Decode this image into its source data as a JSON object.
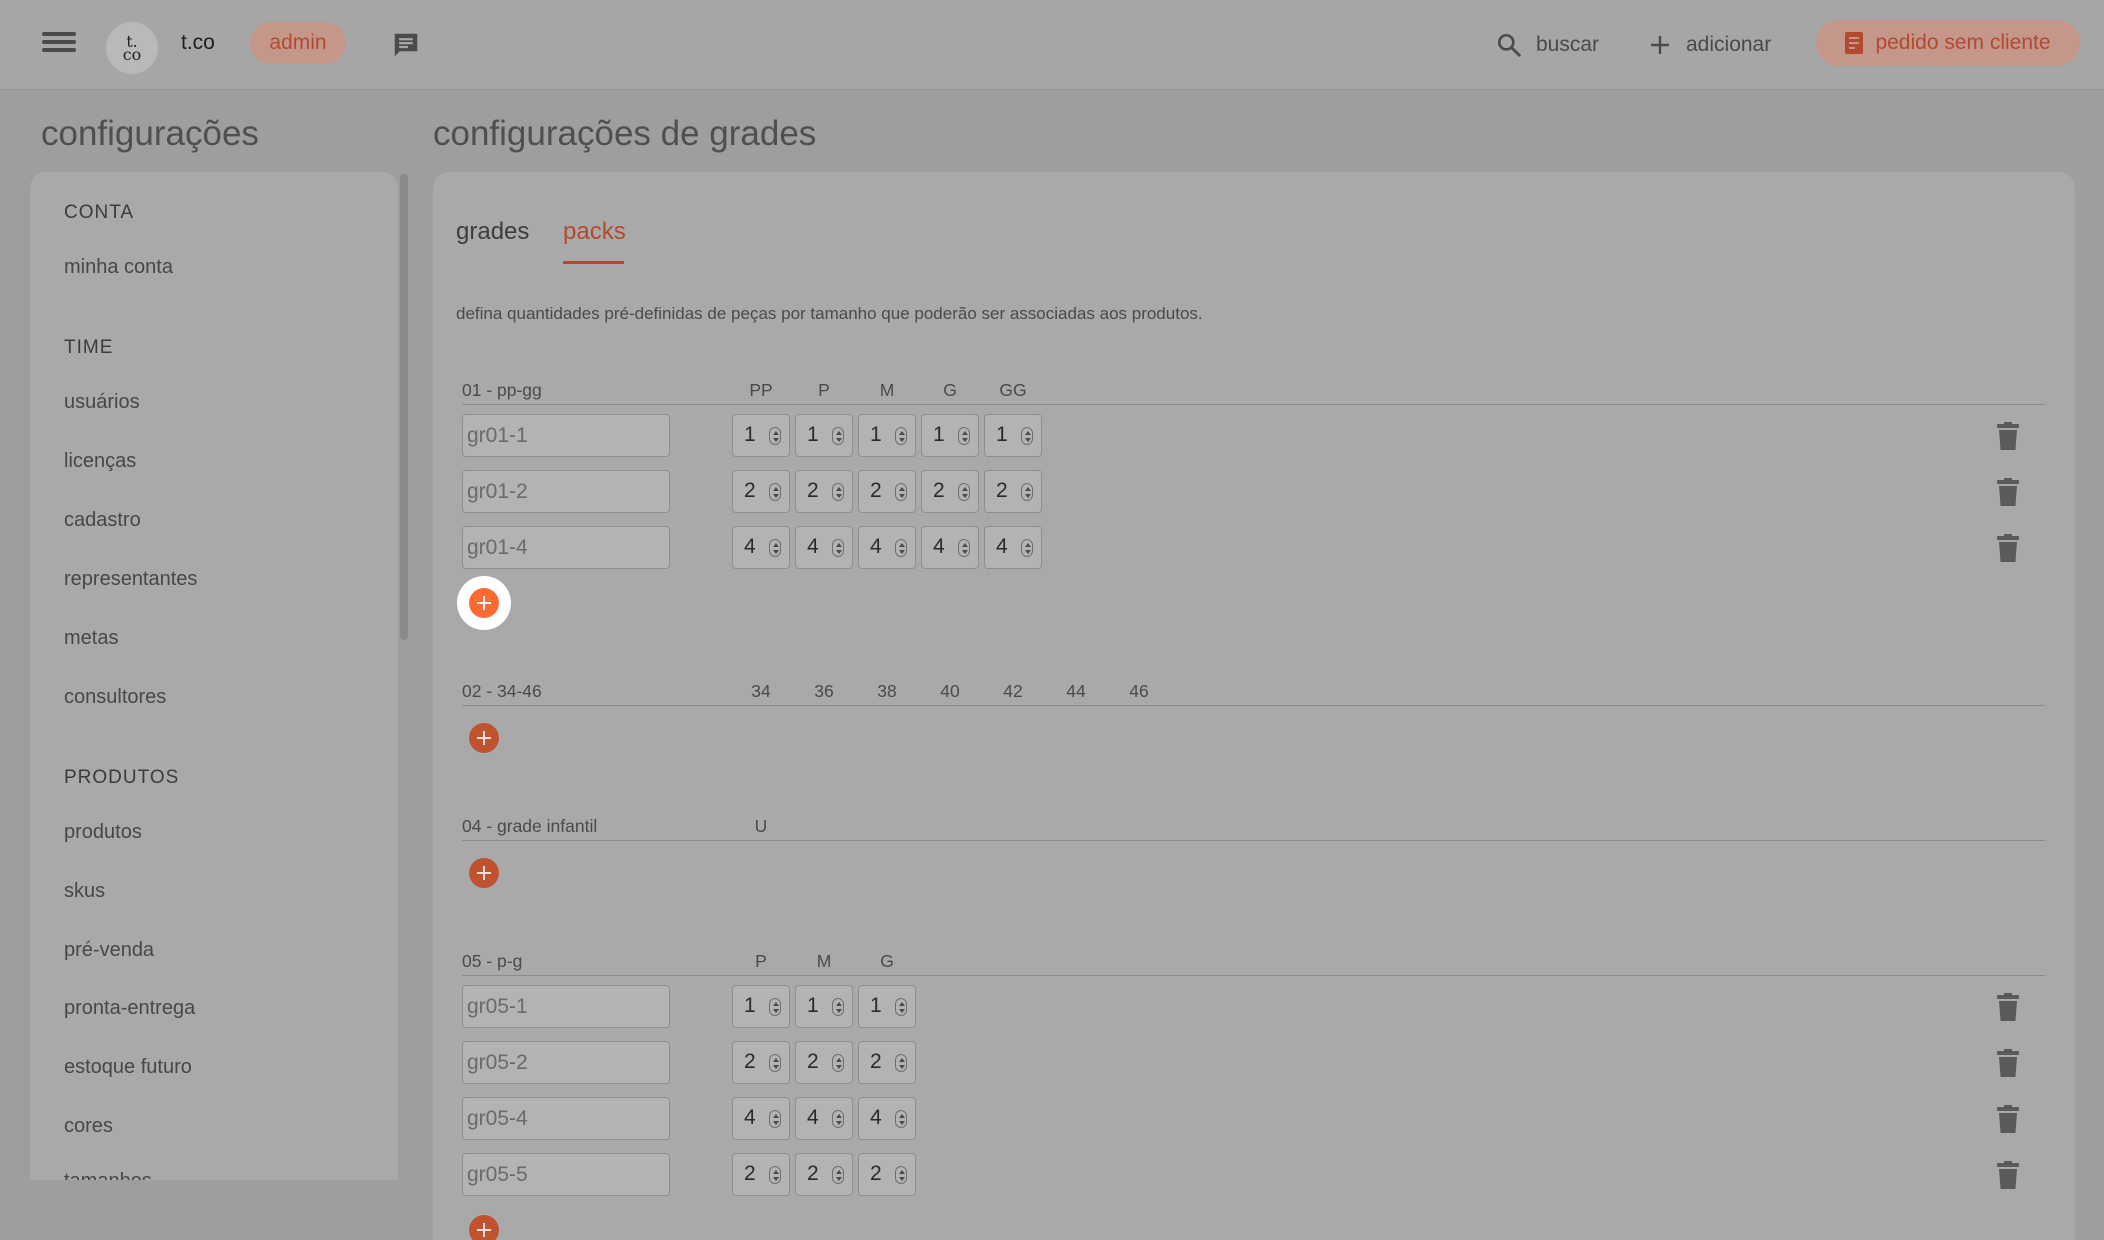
{
  "topbar": {
    "logo_line1": "t.",
    "logo_line2": "co",
    "org_name": "t.co",
    "role": "admin",
    "search_label": "buscar",
    "add_label": "adicionar",
    "order_label": "pedido sem cliente",
    "accent": "#b24a30"
  },
  "sidebar": {
    "title": "configurações",
    "sections": [
      {
        "label": "CONTA",
        "items": [
          "minha conta"
        ]
      },
      {
        "label": "TIME",
        "items": [
          "usuários",
          "licenças",
          "cadastro",
          "representantes",
          "metas",
          "consultores"
        ]
      },
      {
        "label": "PRODUTOS",
        "items": [
          "produtos",
          "skus",
          "pré-venda",
          "pronta-entrega",
          "estoque futuro",
          "cores",
          "tamanhos"
        ]
      }
    ]
  },
  "main": {
    "title": "configurações de grades",
    "tabs": [
      {
        "label": "grades",
        "active": false
      },
      {
        "label": "packs",
        "active": true
      }
    ],
    "description": "defina quantidades pré-definidas de peças por tamanho que poderão ser associadas aos produtos.",
    "grades": [
      {
        "title": "01 - pp-gg",
        "sizes": [
          "PP",
          "P",
          "M",
          "G",
          "GG"
        ],
        "packs": [
          {
            "name": "gr01-1",
            "qty": [
              "1",
              "1",
              "1",
              "1",
              "1"
            ]
          },
          {
            "name": "gr01-2",
            "qty": [
              "2",
              "2",
              "2",
              "2",
              "2"
            ]
          },
          {
            "name": "gr01-4",
            "qty": [
              "4",
              "4",
              "4",
              "4",
              "4"
            ]
          }
        ]
      },
      {
        "title": "02 - 34-46",
        "sizes": [
          "34",
          "36",
          "38",
          "40",
          "42",
          "44",
          "46"
        ],
        "packs": []
      },
      {
        "title": "04 - grade infantil",
        "sizes": [
          "U"
        ],
        "packs": []
      },
      {
        "title": "05 - p-g",
        "sizes": [
          "P",
          "M",
          "G"
        ],
        "packs": [
          {
            "name": "gr05-1",
            "qty": [
              "1",
              "1",
              "1"
            ]
          },
          {
            "name": "gr05-2",
            "qty": [
              "2",
              "2",
              "2"
            ]
          },
          {
            "name": "gr05-4",
            "qty": [
              "4",
              "4",
              "4"
            ]
          },
          {
            "name": "gr05-5",
            "qty": [
              "2",
              "2",
              "2"
            ]
          }
        ]
      }
    ]
  },
  "icons": {
    "menu": "hamburger-icon",
    "chat": "chat-bubble-icon",
    "search": "magnifier-icon",
    "add": "plus-icon",
    "order": "document-icon",
    "delete": "trash-icon",
    "add_pack": "plus-circle-icon"
  }
}
